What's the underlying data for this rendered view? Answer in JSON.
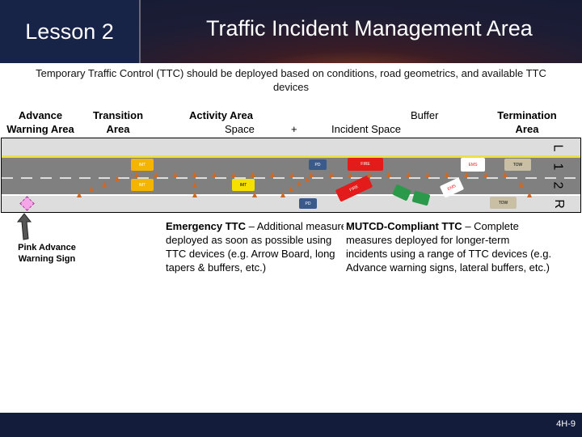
{
  "header": {
    "lesson": "Lesson 2",
    "title": "Traffic Incident Management Area"
  },
  "subtitle": "Temporary Traffic Control (TTC) should be deployed based on conditions, road geometrics, and available TTC devices",
  "zones": {
    "advance": "Advance",
    "warning_area": "Warning Area",
    "transition": "Transition",
    "area": "Area",
    "activity": "Activity Area",
    "space": "Space",
    "plus": "+",
    "buffer": "Buffer",
    "incident": "Incident Space",
    "termination": "Termination",
    "term_area": "Area"
  },
  "lanes": {
    "left": "L",
    "one": "1",
    "two": "2",
    "right": "R"
  },
  "vehicles": {
    "imt": "IMT",
    "pd": "PD",
    "fire": "FIRE",
    "ems": "EMS",
    "tow": "TOW"
  },
  "sign_label": "Pink Advance Warning Sign",
  "emergency": {
    "title": "Emergency TTC",
    "lines": [
      " – Additional measures",
      "deployed as soon as possible using",
      "TTC devices (e.g. Arrow Board, long",
      "tapers & buffers, etc.)"
    ]
  },
  "mutcd": {
    "title": "MUTCD-Compliant TTC",
    "lines": [
      " – Complete",
      "measures deployed for longer-term",
      "incidents using a range of TTC devices (e.g.",
      "Advance warning signs, lateral buffers, etc.)"
    ]
  },
  "footer": {
    "page": "4H-9"
  },
  "colors": {
    "header": "#182348",
    "footer": "#141c3c",
    "pink_sign": "#f4a6e8",
    "cone": "#c96a2a",
    "fire": "#e31b1b"
  }
}
